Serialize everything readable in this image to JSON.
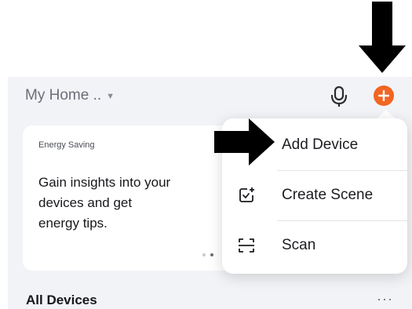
{
  "header": {
    "home_label": "My Home ..",
    "home_caret": "▼",
    "mic_icon": "mic-icon",
    "add_icon": "plus-icon",
    "accent_color": "#f26522"
  },
  "energy_card": {
    "tag": "Energy Saving",
    "text": "Gain insights into your\ndevices and get\nenergy tips."
  },
  "add_menu": {
    "items": [
      {
        "label": "Add Device",
        "icon": ""
      },
      {
        "label": "Create Scene",
        "icon": "create-scene-icon"
      },
      {
        "label": "Scan",
        "icon": "scan-icon"
      }
    ]
  },
  "devices_section": {
    "title": "All Devices",
    "more": "···"
  },
  "annotations": {
    "arrow_color": "#000000",
    "arrow_targets": [
      "add-button",
      "menu-item-add-device"
    ]
  }
}
